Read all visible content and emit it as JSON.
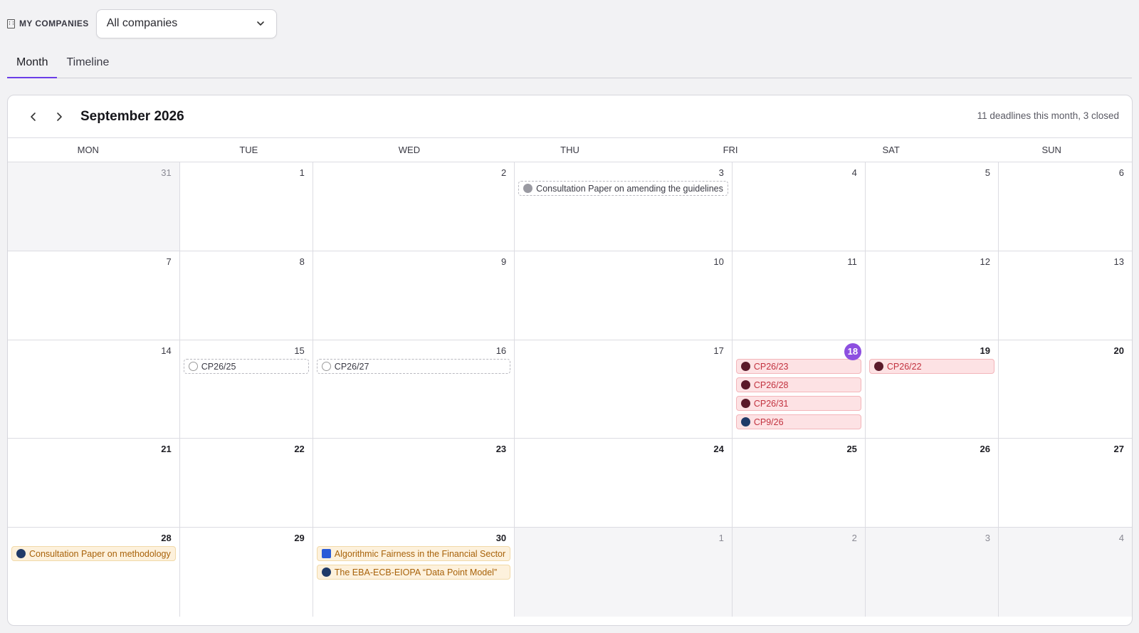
{
  "topbar": {
    "label": "MY COMPANIES",
    "select_value": "All companies"
  },
  "tabs": [
    {
      "label": "Month",
      "active": true
    },
    {
      "label": "Timeline",
      "active": false
    }
  ],
  "calendar": {
    "title": "September 2026",
    "summary": "11 deadlines this month, 3 closed",
    "weekdays": [
      "MON",
      "TUE",
      "WED",
      "THU",
      "FRI",
      "SAT",
      "SUN"
    ],
    "today": "18",
    "weeks": [
      [
        {
          "day": "31",
          "outside": true,
          "events": []
        },
        {
          "day": "1",
          "events": []
        },
        {
          "day": "2",
          "events": []
        },
        {
          "day": "3",
          "events": [
            {
              "label": "Consultation Paper on amending the guidelines",
              "style": "dashed",
              "icon": "grey"
            }
          ]
        },
        {
          "day": "4",
          "events": []
        },
        {
          "day": "5",
          "events": []
        },
        {
          "day": "6",
          "events": []
        }
      ],
      [
        {
          "day": "7",
          "events": []
        },
        {
          "day": "8",
          "events": []
        },
        {
          "day": "9",
          "events": []
        },
        {
          "day": "10",
          "events": []
        },
        {
          "day": "11",
          "events": []
        },
        {
          "day": "12",
          "events": []
        },
        {
          "day": "13",
          "events": []
        }
      ],
      [
        {
          "day": "14",
          "events": []
        },
        {
          "day": "15",
          "events": [
            {
              "label": "CP26/25",
              "style": "dashed",
              "icon": "outline"
            }
          ]
        },
        {
          "day": "16",
          "events": [
            {
              "label": "CP26/27",
              "style": "dashed",
              "icon": "outline"
            }
          ]
        },
        {
          "day": "17",
          "events": []
        },
        {
          "day": "18",
          "today": true,
          "events": [
            {
              "label": "CP26/23",
              "style": "red",
              "icon": "maroon"
            },
            {
              "label": "CP26/28",
              "style": "red",
              "icon": "maroon"
            },
            {
              "label": "CP26/31",
              "style": "red",
              "icon": "maroon"
            },
            {
              "label": "CP9/26",
              "style": "red",
              "icon": "navy"
            }
          ]
        },
        {
          "day": "19",
          "bold": true,
          "events": [
            {
              "label": "CP26/22",
              "style": "red",
              "icon": "maroon"
            }
          ]
        },
        {
          "day": "20",
          "bold": true,
          "events": []
        }
      ],
      [
        {
          "day": "21",
          "bold": true,
          "events": []
        },
        {
          "day": "22",
          "bold": true,
          "events": []
        },
        {
          "day": "23",
          "bold": true,
          "events": []
        },
        {
          "day": "24",
          "bold": true,
          "events": []
        },
        {
          "day": "25",
          "bold": true,
          "events": []
        },
        {
          "day": "26",
          "bold": true,
          "events": []
        },
        {
          "day": "27",
          "bold": true,
          "events": []
        }
      ],
      [
        {
          "day": "28",
          "bold": true,
          "events": [
            {
              "label": "Consultation Paper on methodology",
              "style": "orange",
              "icon": "navy"
            }
          ]
        },
        {
          "day": "29",
          "bold": true,
          "events": []
        },
        {
          "day": "30",
          "bold": true,
          "events": [
            {
              "label": "Algorithmic Fairness in the Financial Sector",
              "style": "orange",
              "icon": "blue"
            },
            {
              "label": "The EBA-ECB-EIOPA “Data Point Model”",
              "style": "orange",
              "icon": "navy"
            }
          ]
        },
        {
          "day": "1",
          "outside": true,
          "events": []
        },
        {
          "day": "2",
          "outside": true,
          "events": []
        },
        {
          "day": "3",
          "outside": true,
          "events": []
        },
        {
          "day": "4",
          "outside": true,
          "events": []
        }
      ]
    ]
  }
}
